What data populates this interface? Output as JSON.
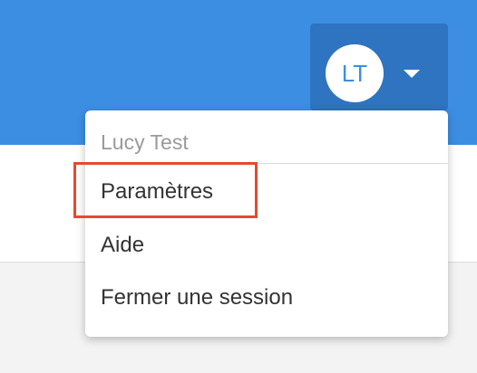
{
  "header": {
    "user_menu": {
      "avatar_initials": "LT",
      "caret_icon": "caret-down-icon"
    }
  },
  "dropdown": {
    "user_name": "Lucy Test",
    "items": [
      {
        "label": "Paramètres"
      },
      {
        "label": "Aide"
      },
      {
        "label": "Fermer une session"
      }
    ]
  },
  "colors": {
    "header_blue": "#3c8ee3",
    "button_blue": "#2f74c0",
    "highlight_red": "#e34a2e"
  }
}
